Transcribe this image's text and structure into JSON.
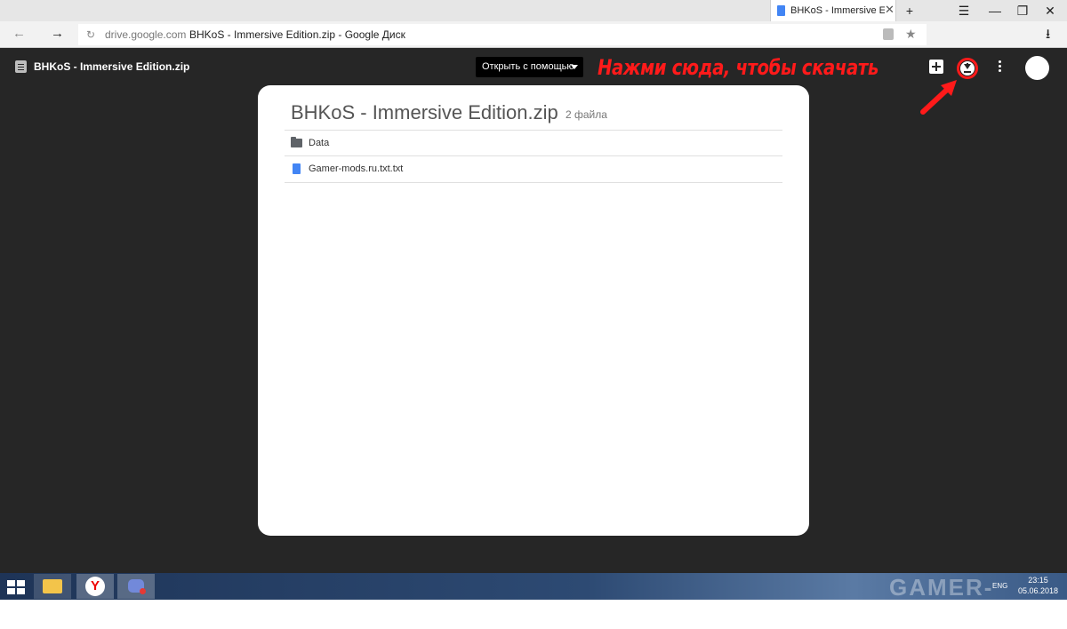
{
  "browser": {
    "tab_title": "BHKoS - Immersive Editio",
    "url_domain": "drive.google.com",
    "url_title": "BHKoS - Immersive Edition.zip - Google Диск"
  },
  "viewer": {
    "file_title": "BHKoS - Immersive Edition.zip",
    "open_with_label": "Открыть с помощью",
    "annotation": "Нажми сюда, чтобы скачать",
    "annotation_color": "#ff1a1a"
  },
  "card": {
    "title": "BHKoS - Immersive Edition.zip",
    "count": "2 файла",
    "items": [
      {
        "label": "Data",
        "icon": "folder-icon"
      },
      {
        "label": "Gamer-mods.ru.txt.txt",
        "icon": "document-icon"
      }
    ]
  },
  "taskbar": {
    "clock_time": "23:15",
    "clock_date": "05.06.2018",
    "language": "ENG",
    "watermark": "GAMER-MODS"
  },
  "colors": {
    "viewer_bg": "#262626",
    "card_bg": "#ffffff",
    "doc_blue": "#4285f4"
  }
}
